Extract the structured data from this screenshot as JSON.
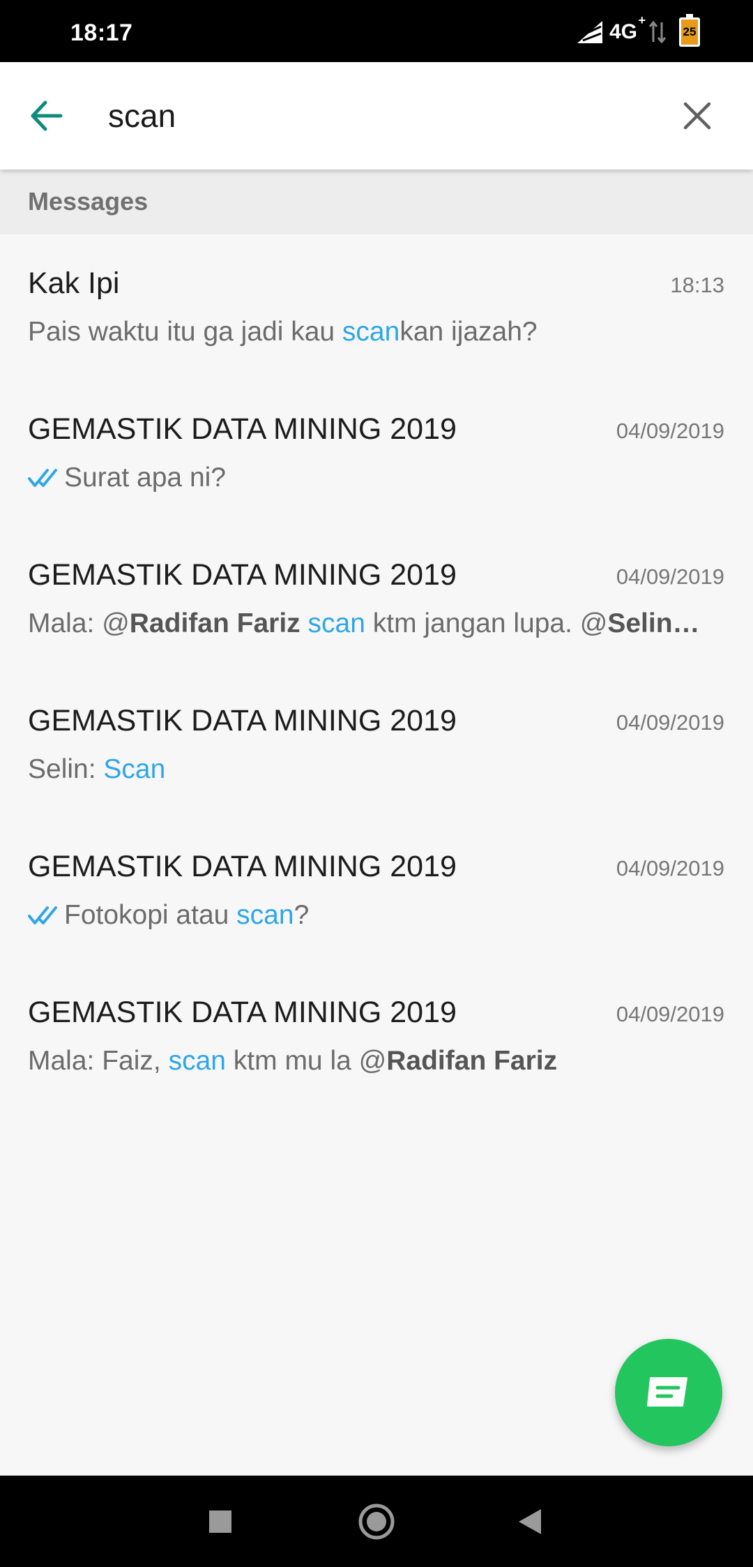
{
  "status_bar": {
    "time": "18:17",
    "network": "4G",
    "network_plus": "+",
    "battery_level": "25",
    "battery_color": "#e69b1a"
  },
  "search": {
    "query": "scan",
    "back_icon": "arrow-left-icon",
    "clear_icon": "close-icon",
    "accent_color": "#0e8b7d"
  },
  "section": {
    "title": "Messages"
  },
  "messages": [
    {
      "title": "Kak Ipi",
      "time": "18:13",
      "tick": false,
      "preview": [
        {
          "text": "Pais waktu itu ga jadi kau ",
          "style": "plain"
        },
        {
          "text": "scan",
          "style": "hl"
        },
        {
          "text": "kan ijazah?",
          "style": "plain"
        }
      ]
    },
    {
      "title": "GEMASTIK DATA MINING 2019",
      "time": "04/09/2019",
      "tick": true,
      "preview": [
        {
          "text": "Surat apa ni?",
          "style": "plain"
        }
      ]
    },
    {
      "title": "GEMASTIK DATA MINING 2019",
      "time": "04/09/2019",
      "tick": false,
      "preview": [
        {
          "text": "Mala: @",
          "style": "plain"
        },
        {
          "text": "Radifan Fariz",
          "style": "mention"
        },
        {
          "text": " ",
          "style": "plain"
        },
        {
          "text": "scan",
          "style": "hl"
        },
        {
          "text": " ktm jangan lupa. @",
          "style": "plain"
        },
        {
          "text": "Selin…",
          "style": "mention"
        }
      ]
    },
    {
      "title": "GEMASTIK DATA MINING 2019",
      "time": "04/09/2019",
      "tick": false,
      "preview": [
        {
          "text": "Selin: ",
          "style": "plain"
        },
        {
          "text": "Scan",
          "style": "hl"
        }
      ]
    },
    {
      "title": "GEMASTIK DATA MINING 2019",
      "time": "04/09/2019",
      "tick": true,
      "preview": [
        {
          "text": "Fotokopi atau ",
          "style": "plain"
        },
        {
          "text": "scan",
          "style": "hl"
        },
        {
          "text": "?",
          "style": "plain"
        }
      ]
    },
    {
      "title": "GEMASTIK DATA MINING 2019",
      "time": "04/09/2019",
      "tick": false,
      "preview": [
        {
          "text": "Mala: Faiz, ",
          "style": "plain"
        },
        {
          "text": "scan",
          "style": "hl"
        },
        {
          "text": " ktm mu la @",
          "style": "plain"
        },
        {
          "text": "Radifan Fariz",
          "style": "mention"
        }
      ]
    }
  ],
  "fab": {
    "icon": "new-chat-icon",
    "color": "#22c55e"
  },
  "nav": {
    "recents_icon": "square-icon",
    "home_icon": "circle-icon",
    "back_icon": "triangle-back-icon"
  }
}
